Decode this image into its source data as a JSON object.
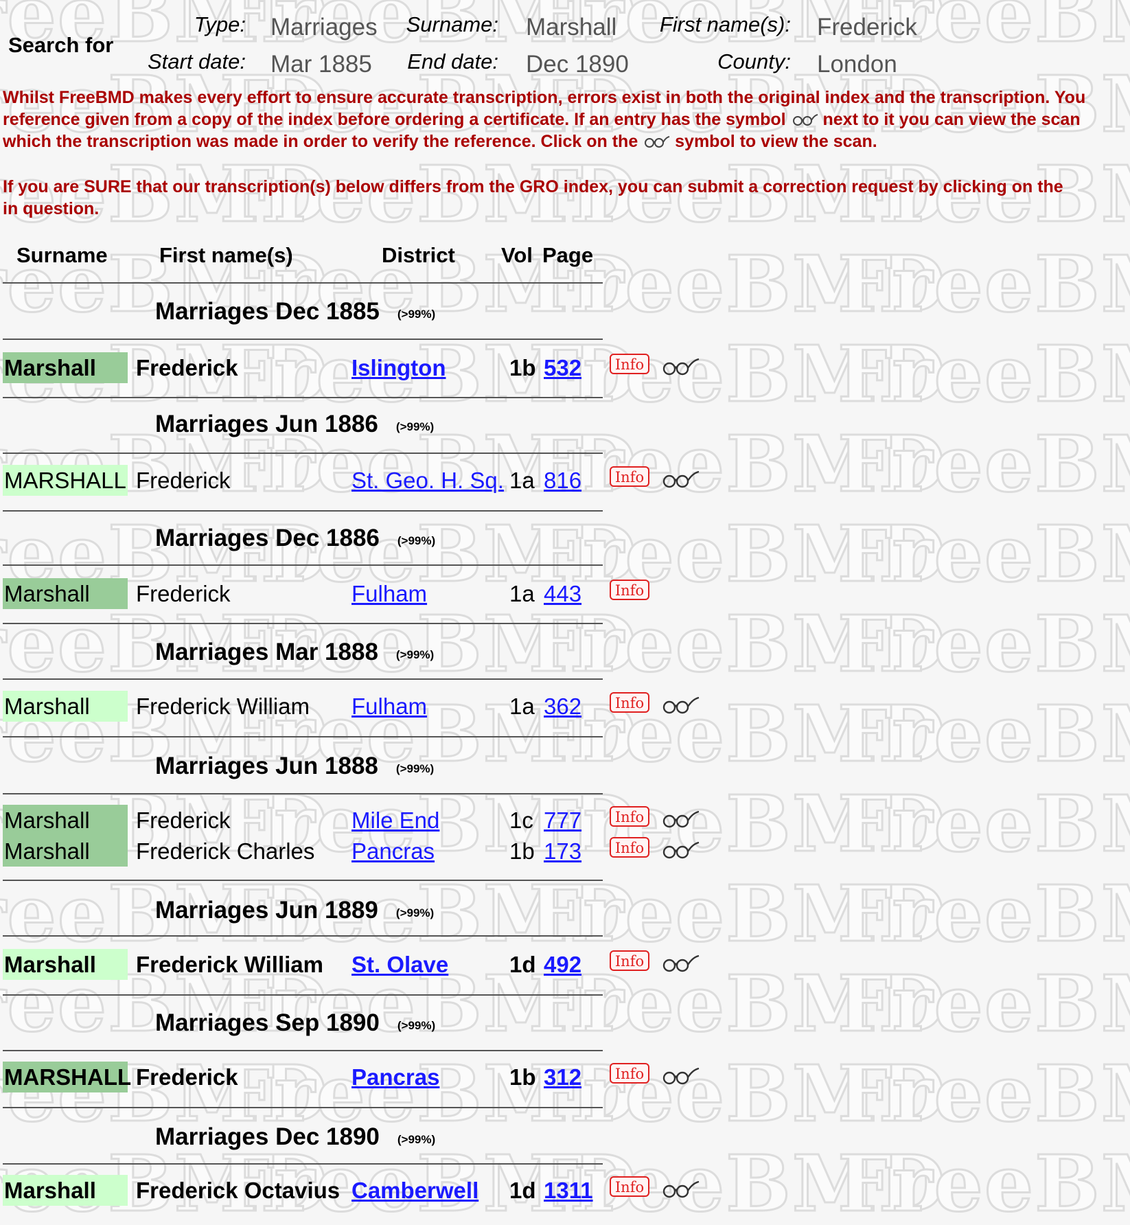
{
  "search": {
    "heading": "Search for",
    "fields": [
      {
        "label": "Type:",
        "value": "Marriages"
      },
      {
        "label": "Surname:",
        "value": "Marshall"
      },
      {
        "label": "First name(s):",
        "value": "Frederick"
      },
      {
        "label": "Start date:",
        "value": "Mar 1885"
      },
      {
        "label": "End date:",
        "value": "Dec 1890"
      },
      {
        "label": "County:",
        "value": "London"
      }
    ]
  },
  "disclaimer": {
    "line1": "Whilst FreeBMD makes every effort to ensure accurate transcription, errors exist in both the original index and the transcription. You",
    "line2a": "reference given from a copy of the index before ordering a certificate. If an entry has the symbol",
    "line2b": "next to it you can view the scan",
    "line3a": "which the transcription was made in order to verify the reference. Click on the",
    "line3b": "symbol to view the scan.",
    "line4": "If you are SURE that our transcription(s) below differs from the GRO index, you can submit a correction request by clicking on the",
    "line5": "in question."
  },
  "columns": {
    "surname": "Surname",
    "first_names": "First name(s)",
    "district": "District",
    "vol": "Vol",
    "page": "Page"
  },
  "watermark_text": "FreeBMD",
  "info_label": "Info",
  "quarters": [
    {
      "heading": "Marriages Dec 1885",
      "confidence": "(>99%)"
    },
    {
      "heading": "Marriages Jun 1886",
      "confidence": "(>99%)"
    },
    {
      "heading": "Marriages Dec 1886",
      "confidence": "(>99%)"
    },
    {
      "heading": "Marriages Mar 1888",
      "confidence": "(>99%)"
    },
    {
      "heading": "Marriages Jun 1888",
      "confidence": "(>99%)"
    },
    {
      "heading": "Marriages Jun 1889",
      "confidence": "(>99%)"
    },
    {
      "heading": "Marriages Sep 1890",
      "confidence": "(>99%)"
    },
    {
      "heading": "Marriages Dec 1890",
      "confidence": "(>99%)"
    }
  ],
  "entries": [
    {
      "surname": "Marshall",
      "first_names": "Frederick",
      "district": "Islington",
      "vol": "1b",
      "page": "532",
      "scan": true
    },
    {
      "surname": "MARSHALL",
      "first_names": "Frederick",
      "district": "St. Geo. H. Sq.",
      "vol": "1a",
      "page": "816",
      "scan": true
    },
    {
      "surname": "Marshall",
      "first_names": "Frederick",
      "district": "Fulham",
      "vol": "1a",
      "page": "443",
      "scan": false
    },
    {
      "surname": "Marshall",
      "first_names": "Frederick William",
      "district": "Fulham",
      "vol": "1a",
      "page": "362",
      "scan": true
    },
    {
      "surname": "Marshall",
      "first_names": "Frederick",
      "district": "Mile End",
      "vol": "1c",
      "page": "777",
      "scan": true
    },
    {
      "surname": "Marshall",
      "first_names": "Frederick Charles",
      "district": "Pancras",
      "vol": "1b",
      "page": "173",
      "scan": true
    },
    {
      "surname": "Marshall",
      "first_names": "Frederick William",
      "district": "St. Olave",
      "vol": "1d",
      "page": "492",
      "scan": true
    },
    {
      "surname": "MARSHALL",
      "first_names": "Frederick",
      "district": "Pancras",
      "vol": "1b",
      "page": "312",
      "scan": true
    },
    {
      "surname": "Marshall",
      "first_names": "Frederick Octavius",
      "district": "Camberwell",
      "vol": "1d",
      "page": "1311",
      "scan": true
    }
  ],
  "colors": {
    "surname_dark": "#99cc99",
    "surname_light": "#ccffcc",
    "disclaimer_text": "#aa0000",
    "link": "#1a1aff",
    "info_red": "#e02020",
    "value_gray": "#555555"
  }
}
